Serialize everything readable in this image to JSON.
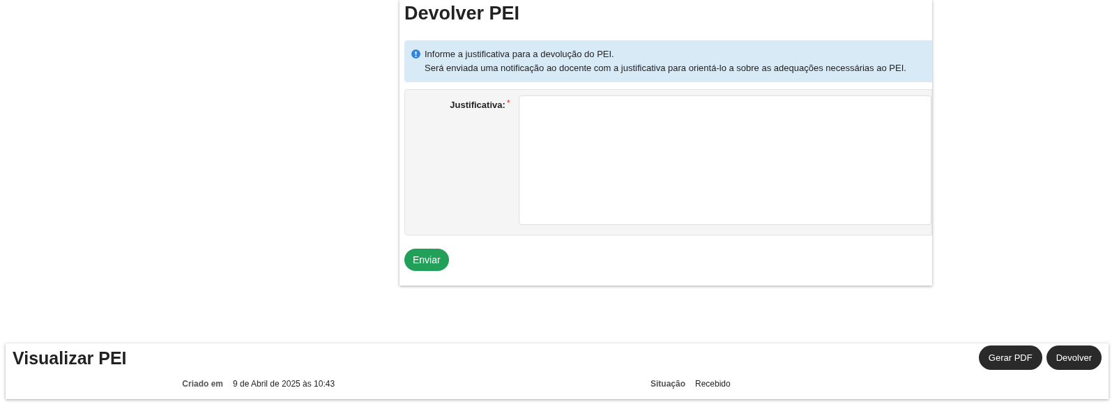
{
  "dialog": {
    "title": "Devolver PEI",
    "alert": {
      "lines": [
        "Informe a justificativa para a devolução do PEI.",
        "Será enviada uma notificação ao docente com a justificativa para orientá-lo a sobre as adequações necessárias ao PEI."
      ]
    },
    "field": {
      "label": "Justificativa:",
      "required": true,
      "required_mark": "*"
    },
    "submit": "Enviar"
  },
  "page": {
    "title": "Visualizar PEI",
    "buttons": [
      "Gerar PDF",
      "Devolver"
    ],
    "details": [
      {
        "label": "Criado em",
        "value": "9 de Abril de 2025 às 10:43"
      },
      {
        "label": "Situação",
        "value": "Recebido"
      }
    ]
  }
}
